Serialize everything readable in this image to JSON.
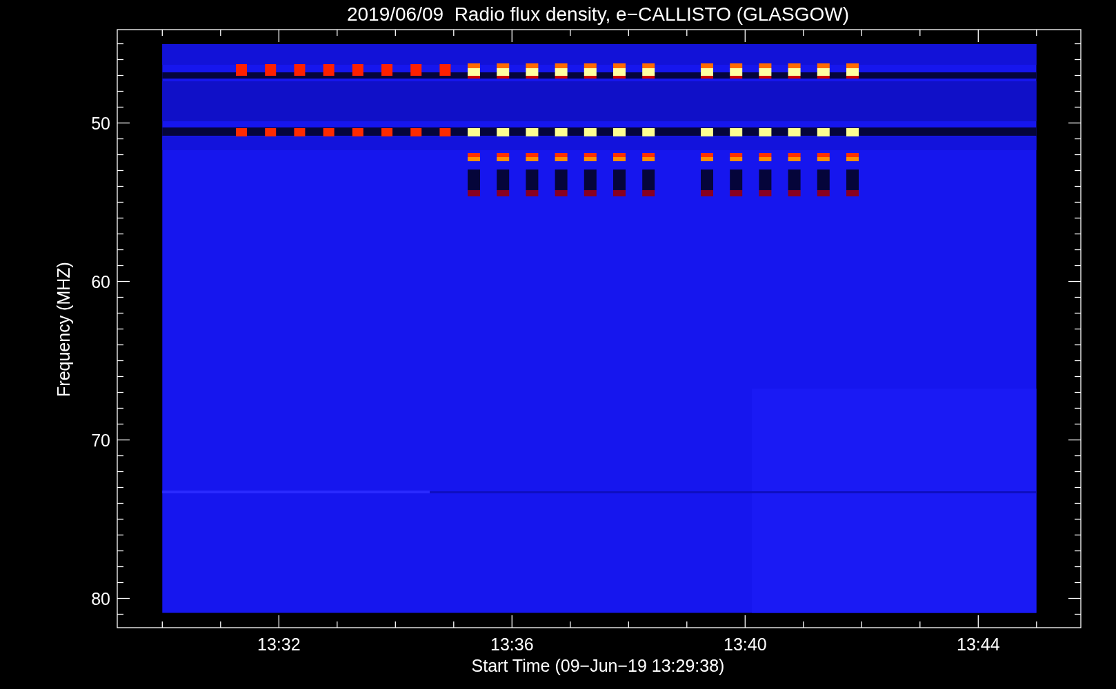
{
  "plot": {
    "title": "2019/06/09  Radio flux density, e−CALLISTO (GLASGOW)",
    "ylabel": "Frequency (MHZ)",
    "xlabel": "Start Time (09−Jun−19 13:29:38)",
    "yticks": [
      "50",
      "60",
      "70",
      "80"
    ],
    "xticks": [
      "13:32",
      "13:36",
      "13:40",
      "13:44"
    ]
  }
}
